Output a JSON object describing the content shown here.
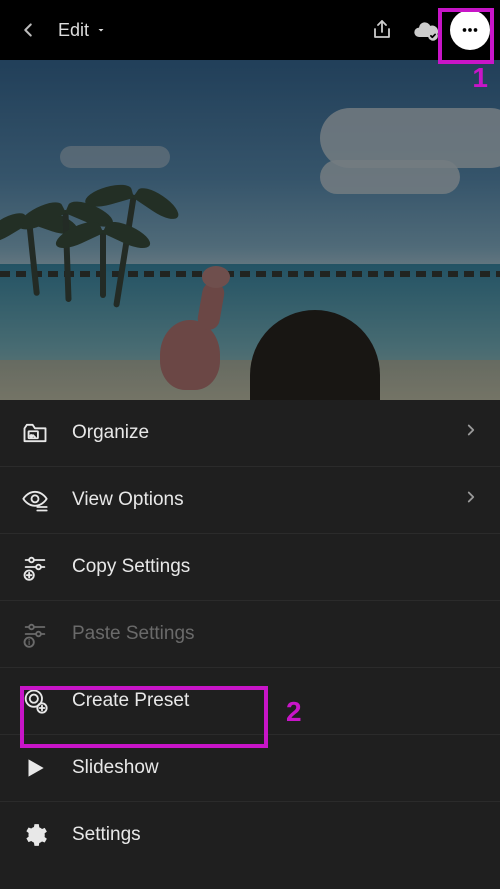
{
  "topbar": {
    "mode_label": "Edit"
  },
  "menu": {
    "items": [
      {
        "label": "Organize",
        "icon": "organize-icon",
        "has_chevron": true,
        "disabled": false
      },
      {
        "label": "View Options",
        "icon": "view-options-icon",
        "has_chevron": true,
        "disabled": false
      },
      {
        "label": "Copy Settings",
        "icon": "copy-settings-icon",
        "has_chevron": false,
        "disabled": false
      },
      {
        "label": "Paste Settings",
        "icon": "paste-settings-icon",
        "has_chevron": false,
        "disabled": true
      },
      {
        "label": "Create Preset",
        "icon": "create-preset-icon",
        "has_chevron": false,
        "disabled": false
      },
      {
        "label": "Slideshow",
        "icon": "slideshow-icon",
        "has_chevron": false,
        "disabled": false
      },
      {
        "label": "Settings",
        "icon": "settings-icon",
        "has_chevron": false,
        "disabled": false
      }
    ]
  },
  "annotations": {
    "callout1": "1",
    "callout2": "2",
    "highlight_color": "#c815c8"
  }
}
